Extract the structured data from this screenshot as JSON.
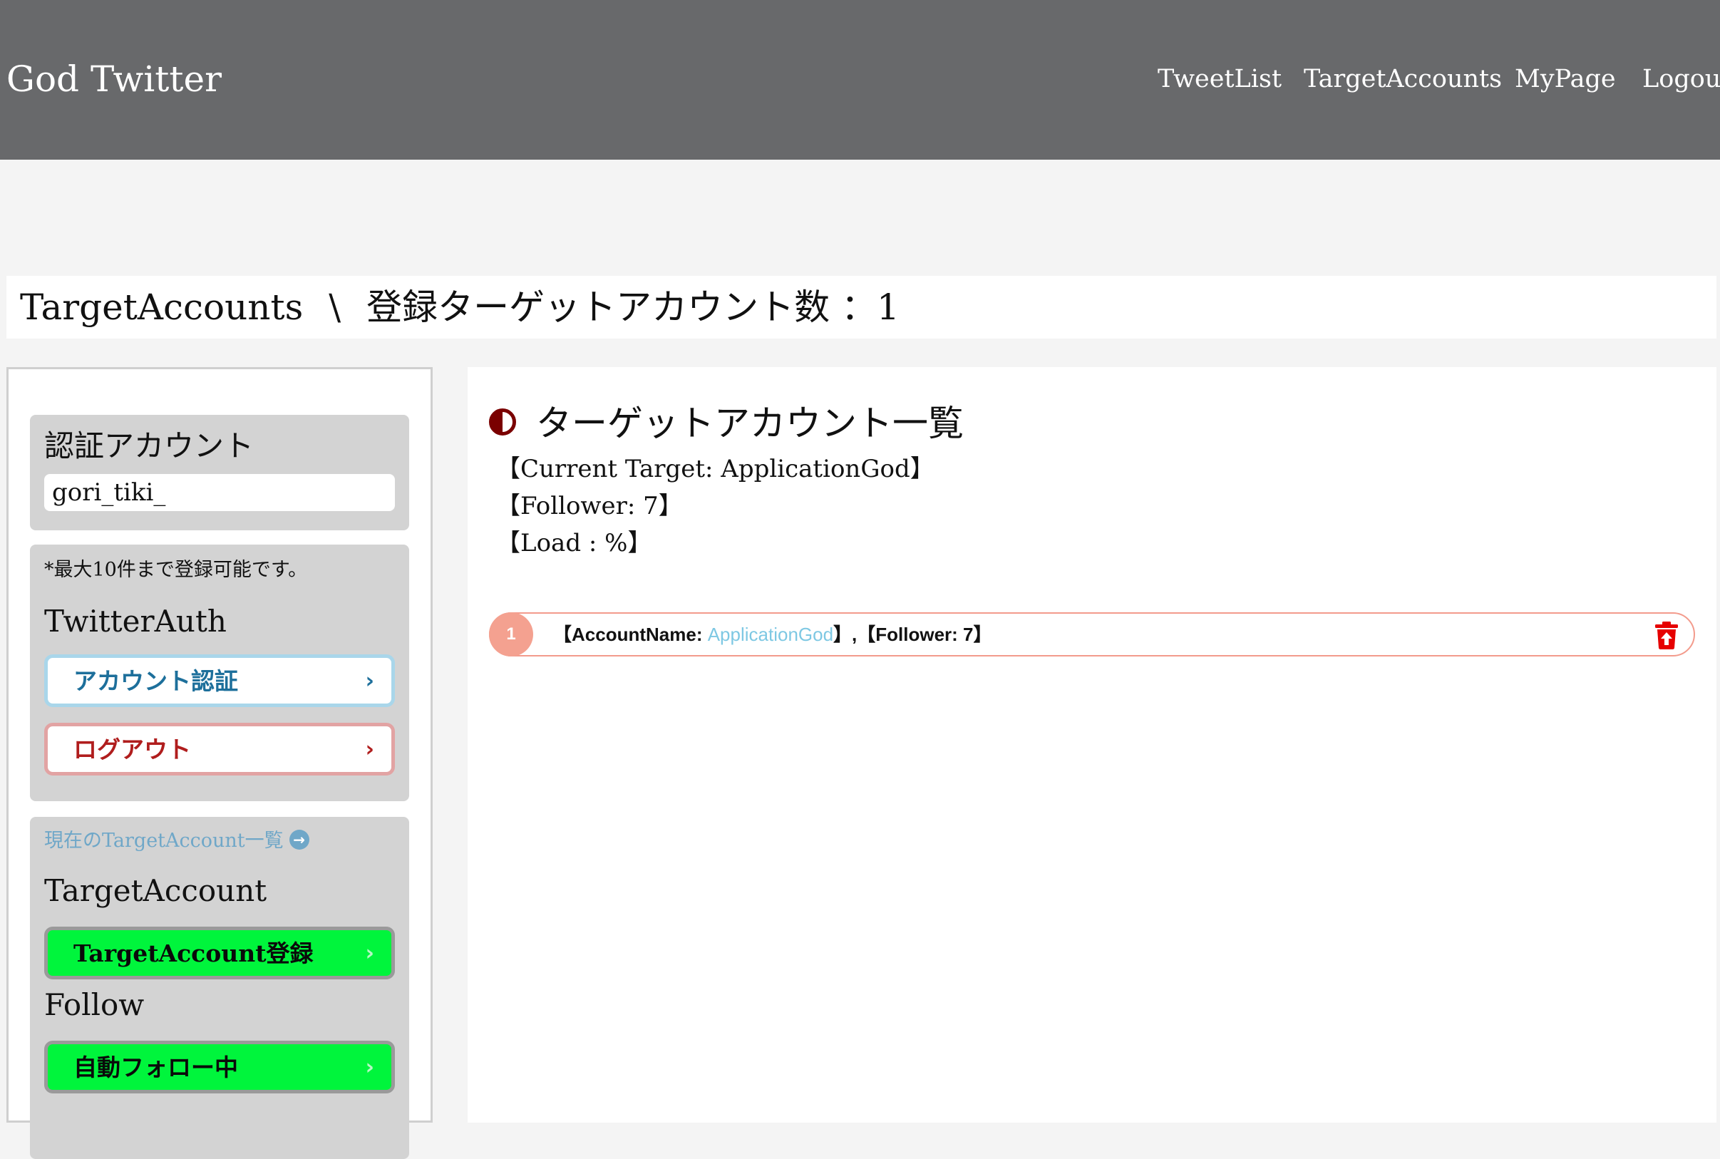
{
  "header": {
    "brand": "God Twitter",
    "nav": [
      "TweetList",
      "TargetAccounts",
      "MyPage",
      "Logout"
    ]
  },
  "page_title": {
    "main": "TargetAccounts",
    "separator": "\\",
    "count_label": "登録ターゲットアカウント数",
    "count_value": "：1"
  },
  "sidebar": {
    "auth_panel": {
      "heading": "認証アカウント",
      "account_value": "gori_tiki_"
    },
    "twitter_panel": {
      "note": "*最大10件まで登録可能です。",
      "heading": "TwitterAuth",
      "auth_button": "アカウント認証",
      "logout_button": "ログアウト"
    },
    "target_panel": {
      "list_link": "現在のTargetAccount一覧",
      "heading_target": "TargetAccount",
      "register_button": "TargetAccount登録",
      "heading_follow": "Follow",
      "follow_button": "自動フォロー中"
    }
  },
  "main": {
    "section_title": "ターゲットアカウント一覧",
    "current_target": "【Current Target: ApplicationGod】",
    "follower": "【Follower: 7】",
    "load": "【Load : %】",
    "accounts": [
      {
        "index": "1",
        "prefix": "【AccountName: ",
        "name": "ApplicationGod",
        "suffix": "】,【Follower: 7】"
      }
    ]
  },
  "colors": {
    "header_bg": "#68696b",
    "accent_dark_red": "#7a0000",
    "link_blue": "#7ec8e3",
    "green_button": "#00f53c",
    "row_border": "#f39b8c"
  }
}
